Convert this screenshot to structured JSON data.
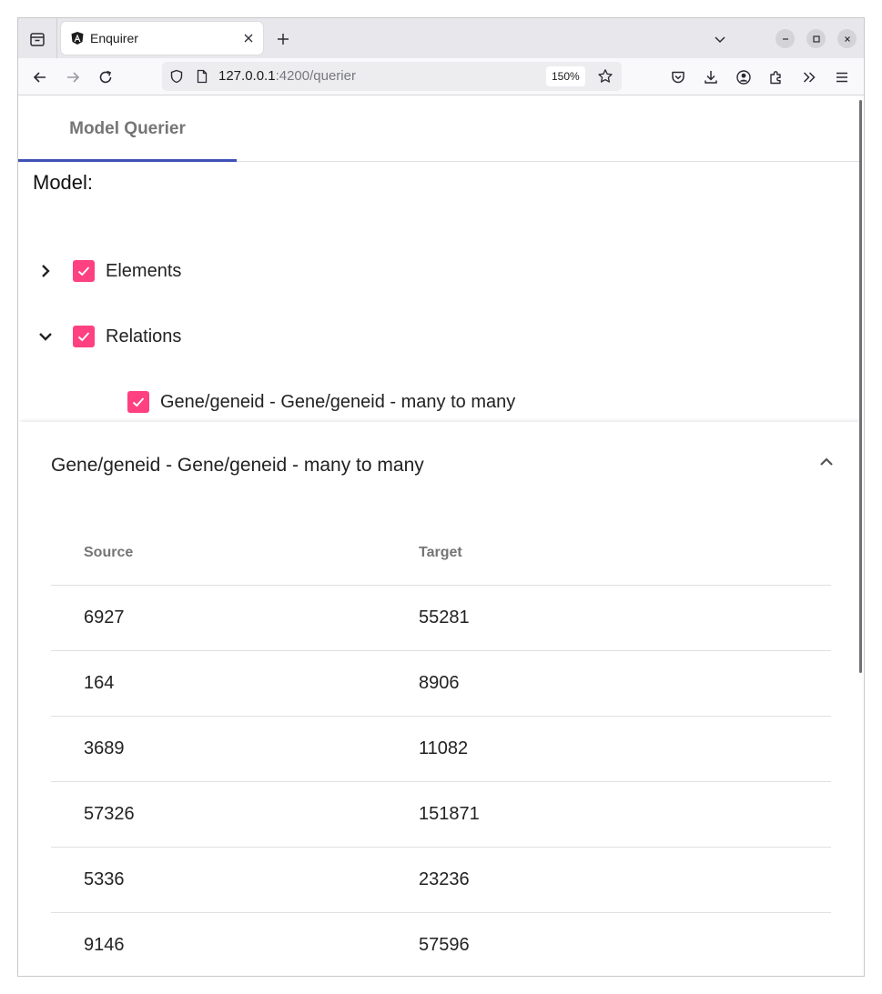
{
  "browser": {
    "tab_title": "Enquirer",
    "url_host": "127.0.0.1",
    "url_rest": ":4200/querier",
    "zoom": "150%"
  },
  "page": {
    "tab_label": "Model Querier",
    "model_label": "Model:",
    "tree": {
      "elements_label": "Elements",
      "relations_label": "Relations",
      "relation_child_label": "Gene/geneid - Gene/geneid - many to many"
    },
    "panel": {
      "title": "Gene/geneid - Gene/geneid - many to many",
      "columns": {
        "source": "Source",
        "target": "Target"
      },
      "rows": [
        {
          "source": "6927",
          "target": "55281"
        },
        {
          "source": "164",
          "target": "8906"
        },
        {
          "source": "3689",
          "target": "11082"
        },
        {
          "source": "57326",
          "target": "151871"
        },
        {
          "source": "5336",
          "target": "23236"
        },
        {
          "source": "9146",
          "target": "57596"
        }
      ]
    }
  },
  "colors": {
    "checkbox": "#ff4081",
    "tab_ink": "#3f51b5"
  }
}
